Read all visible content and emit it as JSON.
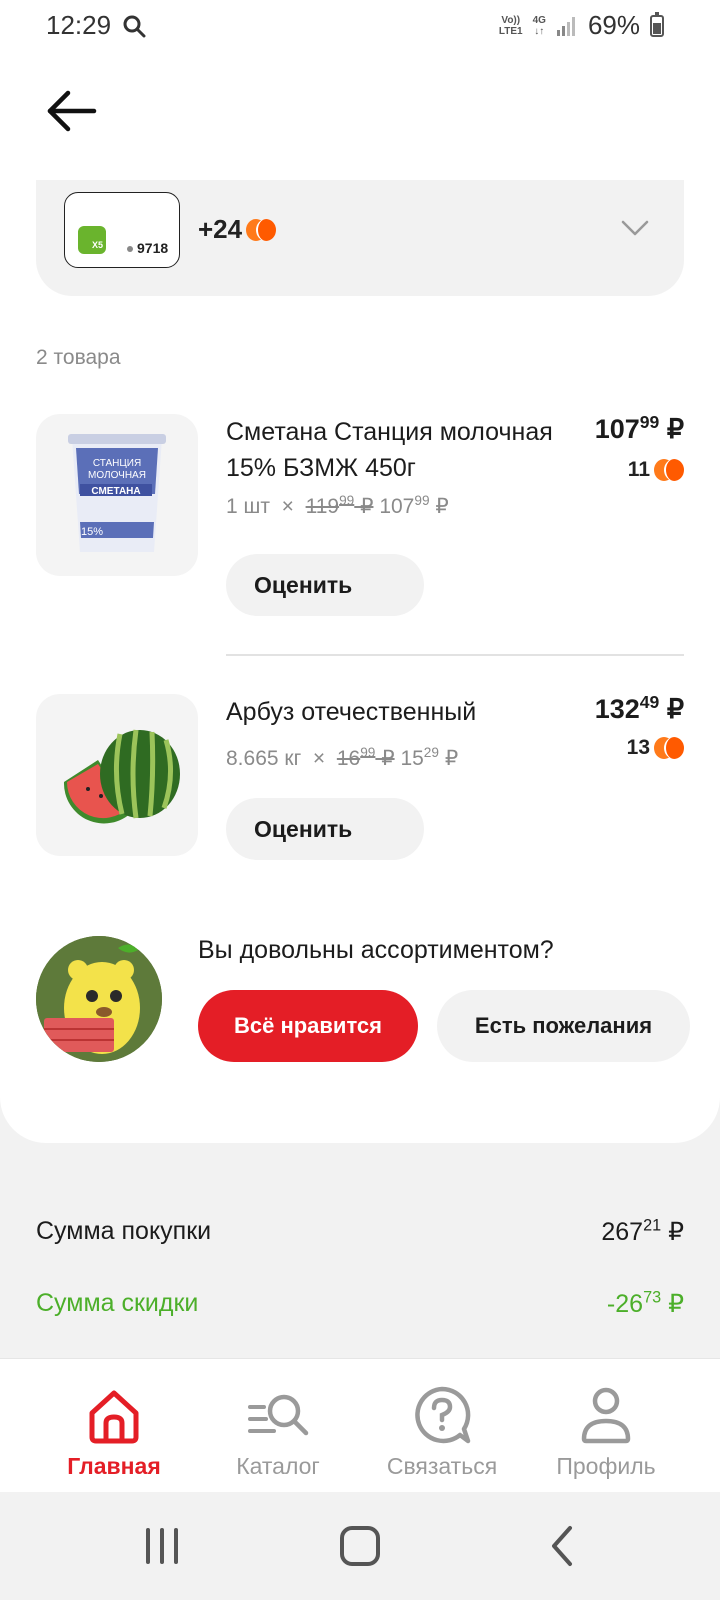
{
  "status_bar": {
    "time": "12:29",
    "volte": "Vo))\nLTE1",
    "network": "4G",
    "battery": "69%"
  },
  "loyalty": {
    "card_number": "9718",
    "card_logo_text": "X5",
    "points_earned": "+24"
  },
  "items_count": "2 товара",
  "items": [
    {
      "name": "Сметана Станция молочная 15% БЗМЖ 450г",
      "price_main": "107",
      "price_kop": "99",
      "currency": "₽",
      "points": "11",
      "quantity": "1 шт",
      "times": "×",
      "old_main": "119",
      "old_kop": "99",
      "new_main": "107",
      "new_kop": "99",
      "rate_label": "Оценить",
      "image_icon": "sour-cream-cup-icon"
    },
    {
      "name": "Арбуз отечественный",
      "price_main": "132",
      "price_kop": "49",
      "currency": "₽",
      "points": "13",
      "quantity": "8.665 кг",
      "times": "×",
      "old_main": "16",
      "old_kop": "99",
      "new_main": "15",
      "new_kop": "29",
      "rate_label": "Оценить",
      "image_icon": "watermelon-icon"
    }
  ],
  "survey": {
    "question": "Вы довольны ассортиментом?",
    "like_label": "Всё нравится",
    "wish_label": "Есть пожелания"
  },
  "summary": {
    "total_label": "Сумма покупки",
    "total_main": "267",
    "total_kop": "21",
    "discount_label": "Сумма скидки",
    "discount_main": "-26",
    "discount_kop": "73",
    "currency": "₽"
  },
  "bottom_nav": [
    {
      "label": "Главная",
      "icon": "home-icon",
      "active": true
    },
    {
      "label": "Каталог",
      "icon": "catalog-search-icon",
      "active": false
    },
    {
      "label": "Связаться",
      "icon": "help-chat-icon",
      "active": false
    },
    {
      "label": "Профиль",
      "icon": "profile-icon",
      "active": false
    }
  ],
  "colors": {
    "accent_red": "#e41e26",
    "discount_green": "#4caf2a",
    "points_orange": "#ff5a00"
  }
}
